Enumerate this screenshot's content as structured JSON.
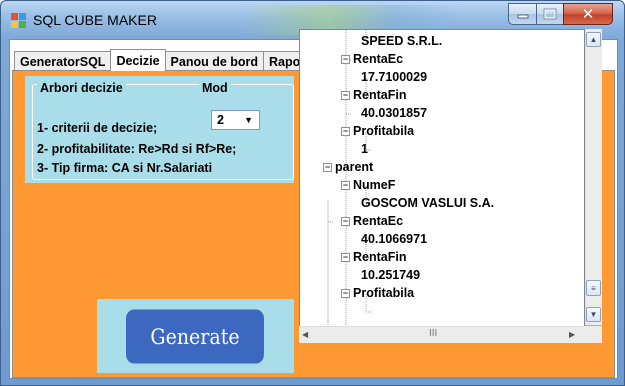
{
  "window": {
    "title": "SQL CUBE MAKER",
    "controls": {
      "minimize": "minimize-icon",
      "maximize": "maximize-icon",
      "close": "close-icon"
    }
  },
  "tabs": [
    {
      "label": "GeneratorSQL",
      "active": false
    },
    {
      "label": "Decizie",
      "active": true
    },
    {
      "label": "Panou de bord",
      "active": false
    },
    {
      "label": "Raport",
      "active": false
    }
  ],
  "decision": {
    "group_title": "Arbori decizie",
    "mod_label": "Mod",
    "mod_value": "2",
    "options": [
      "1- criterii  de decizie;",
      "2- profitabilitate: Re>Rd si Rf>Re;",
      "3- Tip firma: CA si Nr.Salariati"
    ]
  },
  "generate_label": "Generate",
  "tree": [
    {
      "text": "SPEED S.R.L.",
      "kind": "leaf"
    },
    {
      "text": "RentaEc",
      "kind": "node",
      "toggle": "−"
    },
    {
      "text": "17.7100029",
      "kind": "leaf"
    },
    {
      "text": "RentaFin",
      "kind": "node",
      "toggle": "−"
    },
    {
      "text": "40.0301857",
      "kind": "leaf"
    },
    {
      "text": "Profitabila",
      "kind": "node",
      "toggle": "−"
    },
    {
      "text": "1",
      "kind": "leaf"
    },
    {
      "text": "parent",
      "kind": "root",
      "toggle": "−"
    },
    {
      "text": "NumeF",
      "kind": "node",
      "toggle": "−"
    },
    {
      "text": "GOSCOM VASLUI S.A.",
      "kind": "leaf"
    },
    {
      "text": "RentaEc",
      "kind": "node",
      "toggle": "−"
    },
    {
      "text": "40.1066971",
      "kind": "leaf"
    },
    {
      "text": "RentaFin",
      "kind": "node",
      "toggle": "−"
    },
    {
      "text": "10.251749",
      "kind": "leaf"
    },
    {
      "text": "Profitabila",
      "kind": "node",
      "toggle": "−"
    }
  ],
  "colors": {
    "tab_panel": "#ff9933",
    "panel_blue": "#a9dde9",
    "generate_button": "#3d68bf"
  }
}
